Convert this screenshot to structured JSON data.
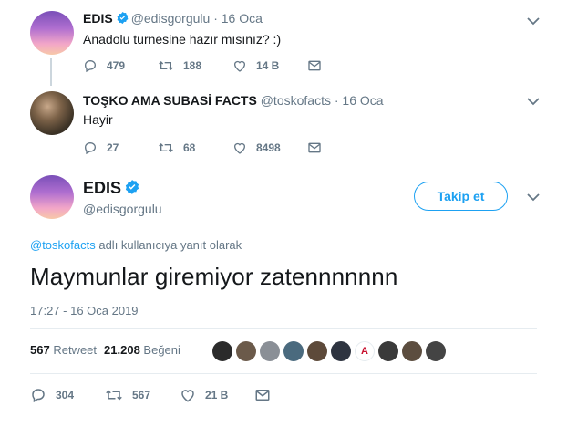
{
  "tweet1": {
    "name": "EDIS",
    "handle": "@edisgorgulu",
    "separator": "·",
    "time": "16 Oca",
    "text": "Anadolu turnesine hazır mısınız? :)",
    "replies": "479",
    "retweets": "188",
    "likes": "14 B"
  },
  "tweet2": {
    "name": "TOŞKO AMA SUBASİ FACTS",
    "handle": "@toskofacts",
    "separator": "·",
    "time": "16 Oca",
    "text": "Hayir",
    "replies": "27",
    "retweets": "68",
    "likes": "8498"
  },
  "main": {
    "name": "EDIS",
    "handle": "@edisgorgulu",
    "follow_label": "Takip et",
    "reply_mention": "@toskofacts",
    "reply_suffix": " adlı kullanıcıya yanıt olarak",
    "text": "Maymunlar giremiyor zatennnnnnn",
    "timestamp": "17:27 - 16 Oca 2019",
    "retweet_count": "567",
    "retweet_label": "Retweet",
    "like_count": "21.208",
    "like_label": "Beğeni",
    "replies": "304",
    "retweets": "567",
    "likes": "21 B",
    "likers": [
      {
        "glyph": "",
        "color": "#2b2b2b"
      },
      {
        "glyph": "",
        "color": "#6b5a4a"
      },
      {
        "glyph": "",
        "color": "#8a8f96"
      },
      {
        "glyph": "",
        "color": "#4a6a7e"
      },
      {
        "glyph": "",
        "color": "#5d4a3a"
      },
      {
        "glyph": "",
        "color": "#2e3440"
      },
      {
        "glyph": "A",
        "color": "#ffffff"
      },
      {
        "glyph": "",
        "color": "#3a3a3a"
      },
      {
        "glyph": "",
        "color": "#5c4d3f"
      },
      {
        "glyph": "",
        "color": "#444444"
      }
    ]
  },
  "colors": {
    "accent": "#1da1f2",
    "text": "#14171a",
    "muted": "#657786",
    "thread_line": "#ccd6dd"
  }
}
